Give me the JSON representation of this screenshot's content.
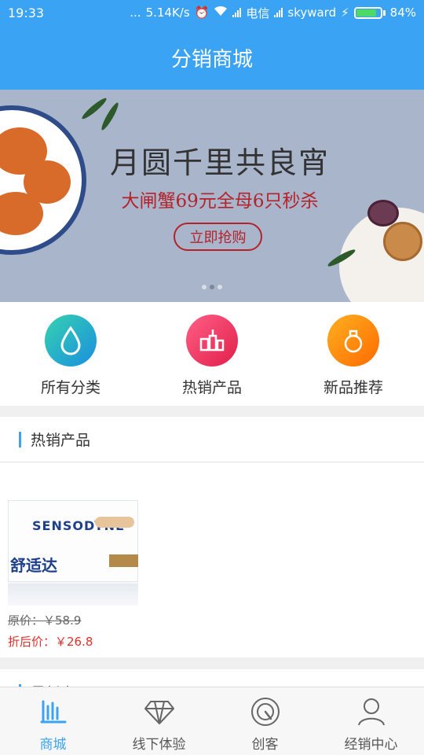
{
  "status_bar": {
    "time": "19:33",
    "dots": "...",
    "speed": "5.14K/s",
    "carrier1": "电信",
    "carrier2": "skyward",
    "battery_pct": "84%",
    "battery_level": 0.84
  },
  "header": {
    "title": "分销商城"
  },
  "banner": {
    "title": "月圆千里共良宵",
    "subtitle": "大闸蟹69元全母6只秒杀",
    "button": "立即抢购",
    "slide_count": 3,
    "active_slide": 1
  },
  "categories": [
    {
      "label": "所有分类",
      "icon": "water-drop-icon"
    },
    {
      "label": "热销产品",
      "icon": "cosmetics-icon"
    },
    {
      "label": "新品推荐",
      "icon": "perfume-icon"
    }
  ],
  "hot_section": {
    "title": "热销产品",
    "products": [
      {
        "image_brand": "SENSODYNE",
        "image_cn": "舒适达",
        "original_price": "原价：￥58.9",
        "discount_price": "折后价：￥26.8"
      }
    ]
  },
  "new_section": {
    "title": "最新产品"
  },
  "tabs": [
    {
      "label": "商城",
      "icon": "mall-icon",
      "active": true
    },
    {
      "label": "线下体验",
      "icon": "diamond-icon",
      "active": false
    },
    {
      "label": "创客",
      "icon": "radar-icon",
      "active": false
    },
    {
      "label": "经销中心",
      "icon": "person-icon",
      "active": false
    }
  ],
  "colors": {
    "primary": "#3ba3f3",
    "price_red": "#e0302a",
    "banner_bg": "#a8b5cb"
  }
}
